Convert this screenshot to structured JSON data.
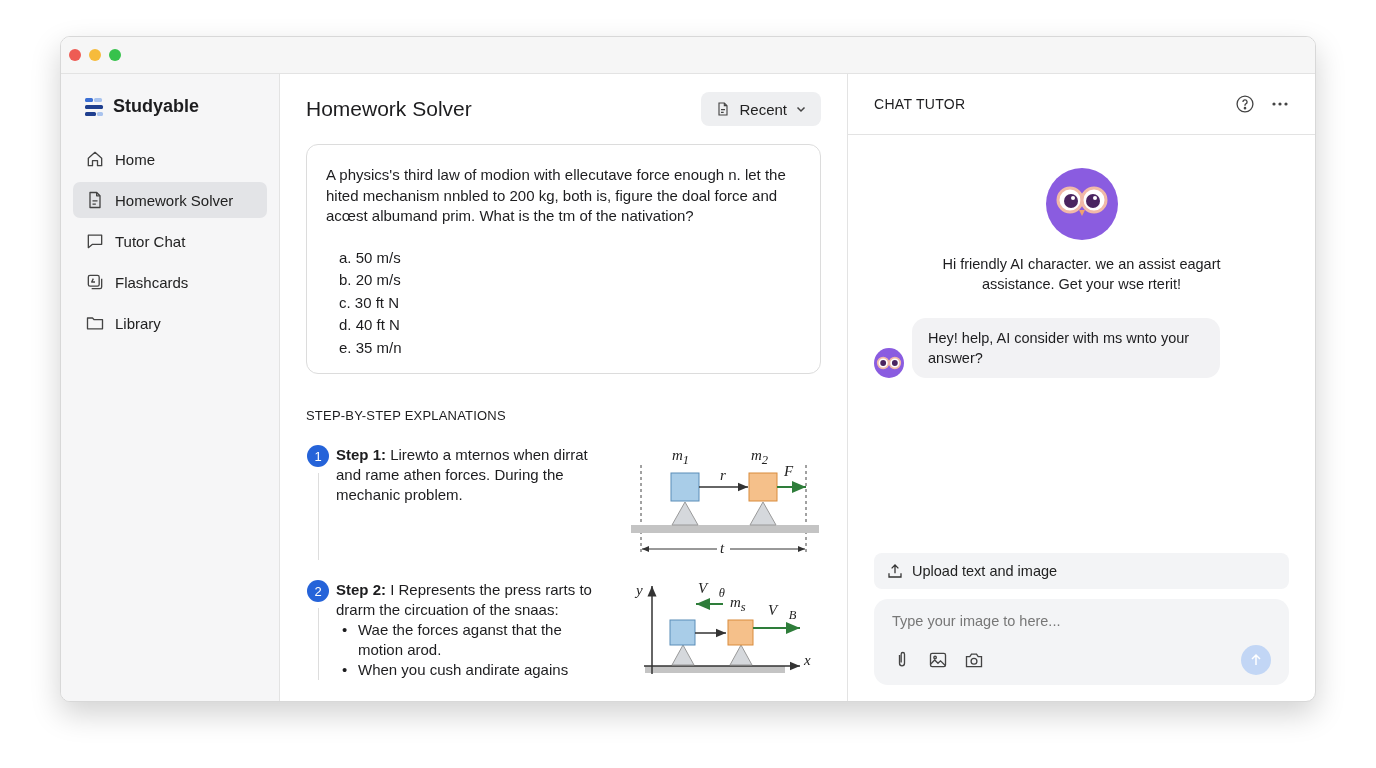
{
  "sidebar": {
    "brand": "Studyable",
    "items": [
      {
        "label": "Home",
        "kind": "home",
        "selected": false
      },
      {
        "label": "Homework Solver",
        "kind": "document",
        "selected": true
      },
      {
        "label": "Tutor Chat",
        "kind": "chat",
        "selected": false
      },
      {
        "label": "Flashcards",
        "kind": "cards",
        "selected": false
      },
      {
        "label": "Library",
        "kind": "folder",
        "selected": false
      }
    ]
  },
  "main": {
    "title": "Homework Solver",
    "recent_button": "Recent",
    "question": {
      "text": "A physics's third law of modion with ellecutave force enough n. let the hited mechanism nnbled to 200 kg, both is, figure the doal force and acœst albumand prim. What is the tm of the nativation?",
      "options": [
        "a. 50 m/s",
        "b. 20 m/s",
        "c. 30 ft N",
        "d. 40 ft N",
        "e. 35 m/n"
      ]
    },
    "section_heading": "STEP-BY-STEP EXPLANATIONS",
    "steps": [
      {
        "number": "1",
        "text": "**Step 1:** Lirewto a mternos when dirrat and rame athen forces. During the mechanic problem.",
        "diagram": {
          "kind": "blocks-on-ground",
          "labels": [
            "m$_{1}$",
            "m$_{2}$",
            "r",
            "F⃗",
            "t"
          ]
        }
      },
      {
        "number": "2",
        "text": "**Step 2:** I Represents the press rarts to drarm the circuation of the snaas:",
        "bullets": [
          {
            "marker": "•",
            "text": "Wae the forces aganst that the motion arod."
          },
          {
            "marker": "•",
            "text": "When you cush andirate agains"
          }
        ],
        "diagram": {
          "kind": "blocks-on-axes",
          "labels": [
            "y",
            "V⃗$_{θ}$",
            "m$_{s}$",
            "V⃗$_{B}$",
            "x"
          ]
        }
      }
    ]
  },
  "chat": {
    "title": "CHAT TUTOR",
    "intro": "Hi friendly AI character. we an assist eagart assistance. Get your wse rterit!",
    "messages": [
      {
        "text": "Hey! help, AI consider with ms wnto your answer?"
      }
    ],
    "upload_button": "Upload text and image",
    "input": {
      "placeholder": "Type your image to here..."
    }
  }
}
